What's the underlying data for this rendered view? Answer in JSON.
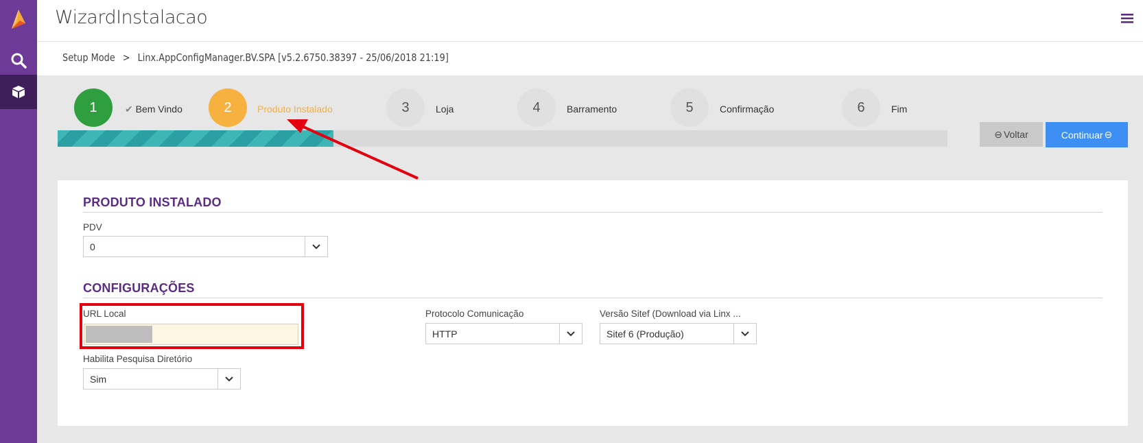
{
  "app": {
    "title": "WizardInstalacao"
  },
  "sidebar": {
    "items": [
      {
        "icon": "logo-icon"
      },
      {
        "icon": "search-icon"
      },
      {
        "icon": "box-icon"
      }
    ]
  },
  "breadcrumb": {
    "root": "Setup Mode",
    "separator": ">",
    "current": "Linx.AppConfigManager.BV.SPA [v5.2.6750.38397 - 25/06/2018 21:19]"
  },
  "wizard": {
    "steps": [
      {
        "number": "1",
        "label": "Bem Vindo",
        "state": "done"
      },
      {
        "number": "2",
        "label": "Produto Instalado",
        "state": "active"
      },
      {
        "number": "3",
        "label": "Loja",
        "state": "pending"
      },
      {
        "number": "4",
        "label": "Barramento",
        "state": "pending"
      },
      {
        "number": "5",
        "label": "Confirmação",
        "state": "pending"
      },
      {
        "number": "6",
        "label": "Fim",
        "state": "pending"
      }
    ],
    "progress_fraction": 0.31,
    "back_label": "Voltar",
    "next_label": "Continuar"
  },
  "form": {
    "produto": {
      "title": "PRODUTO INSTALADO",
      "pdv_label": "PDV",
      "pdv_value": "0"
    },
    "config": {
      "title": "CONFIGURAÇÕES",
      "url_label": "URL Local",
      "url_value": "",
      "protocolo_label": "Protocolo Comunicação",
      "protocolo_value": "HTTP",
      "versao_label": "Versão Sitef (Download via Linx ...",
      "versao_value": "Sitef 6 (Produção)",
      "habilita_label": "Habilita Pesquisa Diretório",
      "habilita_value": "Sim"
    }
  },
  "colors": {
    "sidebar": "#6d3b97",
    "step_done": "#2e9e3f",
    "step_active": "#f6b13f",
    "step_pending": "#e0e0e0",
    "primary_button": "#3d8ff4",
    "section_title": "#5a2d82",
    "annotation": "#e3000f"
  }
}
